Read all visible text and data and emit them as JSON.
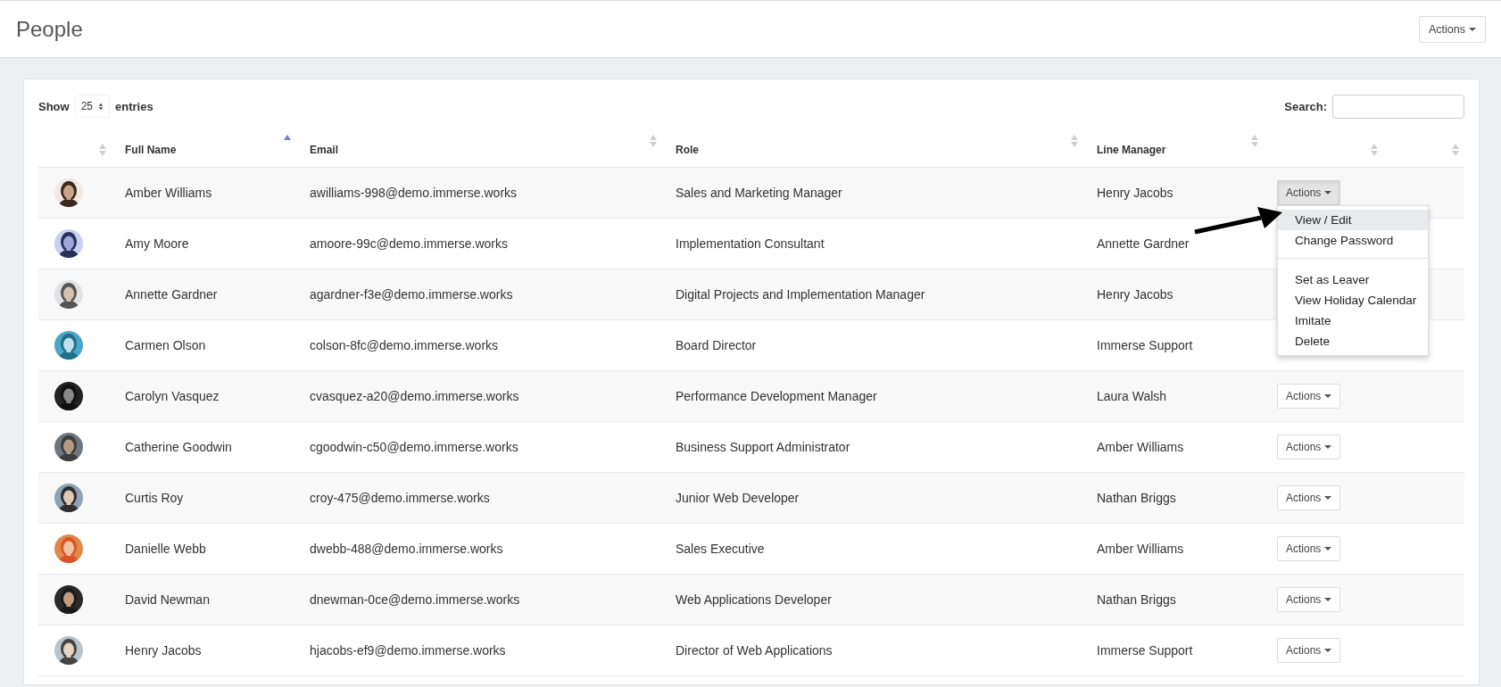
{
  "page": {
    "title": "People",
    "actions_button": "Actions"
  },
  "table_controls": {
    "show_label": "Show",
    "page_size": "25",
    "entries_label": "entries",
    "search_label": "Search:"
  },
  "columns": [
    {
      "sorted_ascending": false
    },
    {
      "label": "Full Name",
      "sorted_ascending": true
    },
    {
      "label": "Email",
      "sorted_ascending": false
    },
    {
      "label": "Role",
      "sorted_ascending": false
    },
    {
      "label": "Line Manager",
      "sorted_ascending": false
    },
    {
      "sorted_ascending": false
    },
    {
      "sorted_ascending": false
    }
  ],
  "rows": [
    {
      "name": "Amber Williams",
      "email": "awilliams-998@demo.immerse.works",
      "role": "Sales and Marketing Manager",
      "line_manager": "Henry Jacobs",
      "action": {
        "label": "Actions",
        "active": true,
        "menu": [
          {
            "kind": "item",
            "label": "View / Edit",
            "selected": true
          },
          {
            "kind": "item",
            "label": "Change Password",
            "selected": false
          },
          {
            "kind": "divider"
          },
          {
            "kind": "item",
            "label": "Set as Leaver",
            "selected": false
          },
          {
            "kind": "item",
            "label": "View Holiday Calendar",
            "selected": false
          },
          {
            "kind": "item",
            "label": "Imitate",
            "selected": false
          },
          {
            "kind": "item",
            "label": "Delete",
            "selected": false
          }
        ]
      }
    },
    {
      "name": "Amy Moore",
      "email": "amoore-99c@demo.immerse.works",
      "role": "Implementation Consultant",
      "line_manager": "Annette Gardner"
    },
    {
      "name": "Annette Gardner",
      "email": "agardner-f3e@demo.immerse.works",
      "role": "Digital Projects and Implementation Manager",
      "line_manager": "Henry Jacobs"
    },
    {
      "name": "Carmen Olson",
      "email": "colson-8fc@demo.immerse.works",
      "role": "Board Director",
      "line_manager": "Immerse Support"
    },
    {
      "name": "Carolyn Vasquez",
      "email": "cvasquez-a20@demo.immerse.works",
      "role": "Performance Development Manager",
      "line_manager": "Laura Walsh",
      "action": {
        "label": "Actions",
        "active": false
      }
    },
    {
      "name": "Catherine Goodwin",
      "email": "cgoodwin-c50@demo.immerse.works",
      "role": "Business Support Administrator",
      "line_manager": "Amber Williams",
      "action": {
        "label": "Actions",
        "active": false
      }
    },
    {
      "name": "Curtis Roy",
      "email": "croy-475@demo.immerse.works",
      "role": "Junior Web Developer",
      "line_manager": "Nathan Briggs",
      "action": {
        "label": "Actions",
        "active": false
      }
    },
    {
      "name": "Danielle Webb",
      "email": "dwebb-488@demo.immerse.works",
      "role": "Sales Executive",
      "line_manager": "Amber Williams",
      "action": {
        "label": "Actions",
        "active": false
      }
    },
    {
      "name": "David Newman",
      "email": "dnewman-0ce@demo.immerse.works",
      "role": "Web Applications Developer",
      "line_manager": "Nathan Briggs",
      "action": {
        "label": "Actions",
        "active": false
      }
    },
    {
      "name": "Henry Jacobs",
      "email": "hjacobs-ef9@demo.immerse.works",
      "role": "Director of Web Applications",
      "line_manager": "Immerse Support",
      "action": {
        "label": "Actions",
        "active": false
      }
    }
  ],
  "annotation": {
    "kind": "arrow"
  }
}
